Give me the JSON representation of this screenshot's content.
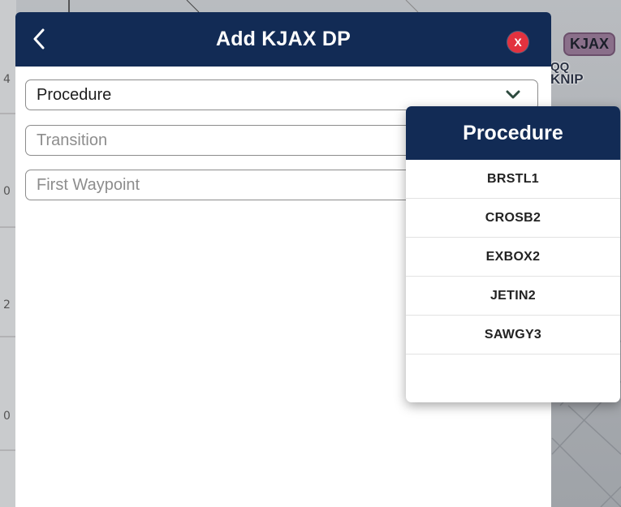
{
  "dialog": {
    "title": "Add KJAX DP",
    "close_label": "X",
    "fields": {
      "procedure": {
        "value": "Procedure"
      },
      "transition": {
        "placeholder": "Transition"
      },
      "first_waypoint": {
        "placeholder": "First Waypoint"
      }
    }
  },
  "dropdown": {
    "title": "Procedure",
    "items": [
      "BRSTL1",
      "CROSB2",
      "EXBOX2",
      "JETIN2",
      "SAWGY3"
    ]
  },
  "map": {
    "labels": {
      "airport_1": "KJAX",
      "airport_2": "KNIP",
      "partial": "QQ"
    },
    "axis_fragments": [
      "4",
      "0",
      "2",
      "0"
    ]
  },
  "colors": {
    "header_navy": "#122b55",
    "close_red": "#e2323f",
    "field_border": "#8c8c8c"
  }
}
